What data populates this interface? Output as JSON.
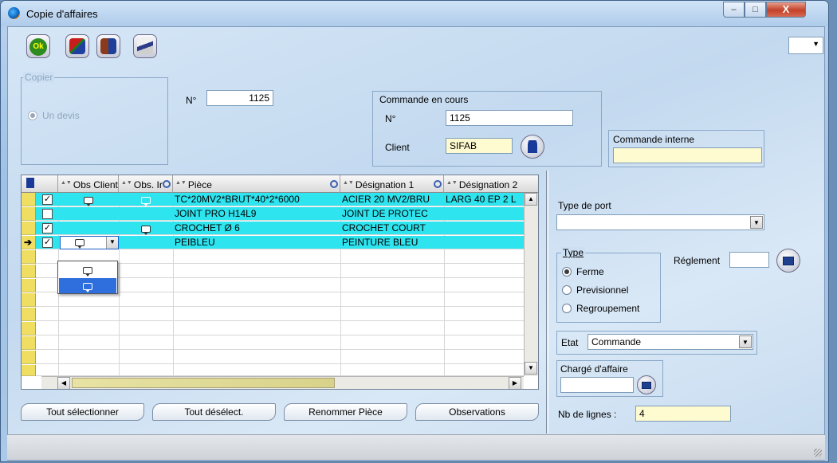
{
  "window": {
    "title": "Copie d'affaires",
    "close_glyph": "X",
    "min_glyph": "–",
    "max_glyph": "□"
  },
  "toolbar": {
    "ok_label": "Ok",
    "buttons": [
      {
        "name": "ok-button",
        "icon": "ok-icon"
      },
      {
        "name": "delete-button",
        "icon": "delete-icon"
      },
      {
        "name": "exit-button",
        "icon": "exit-icon"
      },
      {
        "name": "print-button",
        "icon": "print-icon"
      }
    ],
    "dropdown_arrow": "▼"
  },
  "copier": {
    "group_label": "Copier",
    "option_label": "Un devis"
  },
  "numero": {
    "label": "N°",
    "value": "1125"
  },
  "commande_en_cours": {
    "group_label": "Commande en cours",
    "no_label": "N°",
    "no_value": "1125",
    "client_label": "Client",
    "client_value": "SIFAB"
  },
  "commande_interne": {
    "label": "Commande interne",
    "value": ""
  },
  "grid": {
    "headers": {
      "obs_client": "Obs Client",
      "obs_ir": "Obs. Ir",
      "piece": "Pièce",
      "designation1": "Désignation 1",
      "designation2": "Désignation 2"
    },
    "rows": [
      {
        "checked": "✓",
        "piece": "TC*20MV2*BRUT*40*2*6000",
        "designation1": "ACIER 20 MV2/BRU",
        "designation2": "LARG 40 EP 2 L"
      },
      {
        "checked": "",
        "piece": "JOINT PRO H14L9",
        "designation1": "JOINT DE PROTEC",
        "designation2": ""
      },
      {
        "checked": "✓",
        "piece": "CROCHET Ø 6",
        "designation1": "CROCHET COURT",
        "designation2": ""
      },
      {
        "checked": "✓",
        "piece": "PEIBLEU",
        "designation1": "PEINTURE BLEU",
        "designation2": ""
      }
    ],
    "current_row_marker": "➔"
  },
  "buttons": {
    "select_all": "Tout sélectionner",
    "deselect_all": "Tout désélect.",
    "rename": "Renommer Pièce",
    "observations": "Observations"
  },
  "type_de_port": {
    "label": "Type de port",
    "value": ""
  },
  "type": {
    "group_label": "Type",
    "options": [
      "Ferme",
      "Previsionnel",
      "Regroupement"
    ],
    "selected": "Ferme"
  },
  "reglement": {
    "label": "Réglement",
    "value": ""
  },
  "etat": {
    "label": "Etat",
    "value": "Commande"
  },
  "charge_affaire": {
    "label": "Chargé d'affaire",
    "value": ""
  },
  "nb_lignes": {
    "label": "Nb de lignes :",
    "value": "4"
  }
}
